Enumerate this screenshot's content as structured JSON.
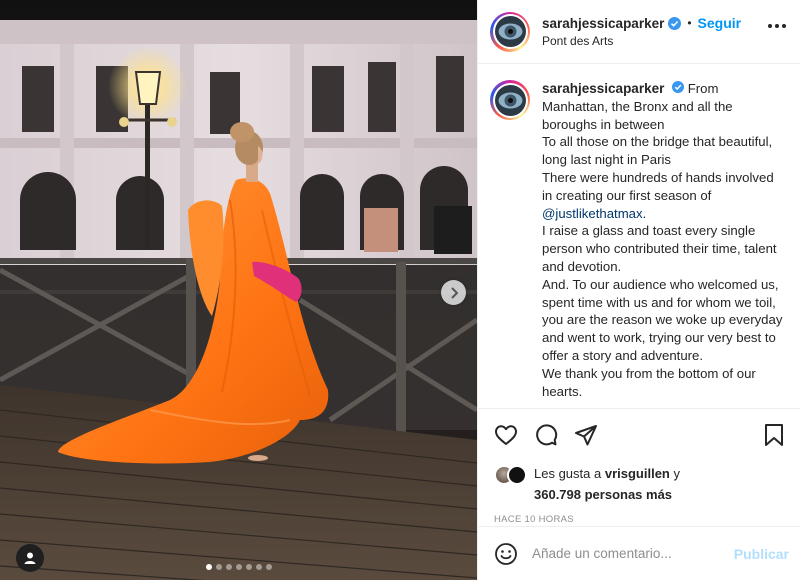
{
  "post": {
    "username": "sarahjessicaparker",
    "follow_label": "Seguir",
    "separator": "•",
    "location": "Pont des Arts",
    "caption_lines": [
      "From Manhattan, the Bronx and all the boroughs in between",
      "To all those on the bridge that beautiful, long last night in Paris",
      "There were hundreds of hands involved in creating our first season of",
      "@justlikethatmax",
      "I raise a glass and toast every single person who contributed their time, talent and devotion.",
      "And. To our audience who welcomed us, spent time with us and for whom we toil, you are the reason we woke up everyday and went to work, trying our very best to offer a story and adventure.",
      "We thank you from the bottom of our hearts."
    ],
    "caption_period": ".",
    "likes_prefix": "Les gusta a",
    "likes_user": "vrisguillen",
    "likes_joiner": "y",
    "likes_count": "360.798 personas más",
    "time_ago": "HACE 10 HORAS",
    "carousel_total": 7,
    "carousel_active": 0
  },
  "comment": {
    "placeholder": "Añade un comentario...",
    "publish_label": "Publicar"
  },
  "icons": {
    "like": "heart-icon",
    "comment": "comment-icon",
    "share": "share-icon",
    "save": "bookmark-icon",
    "emoji": "emoji-icon",
    "more": "more-options-icon",
    "verified": "verified-badge-icon",
    "next": "chevron-right-icon",
    "tag": "user-tag-icon"
  },
  "colors": {
    "accent": "#0095f6",
    "publish_disabled": "#b2dffc",
    "text": "#262626",
    "muted": "#8e8e8e",
    "dress": "#ff7a1a",
    "mention": "#00376b"
  }
}
